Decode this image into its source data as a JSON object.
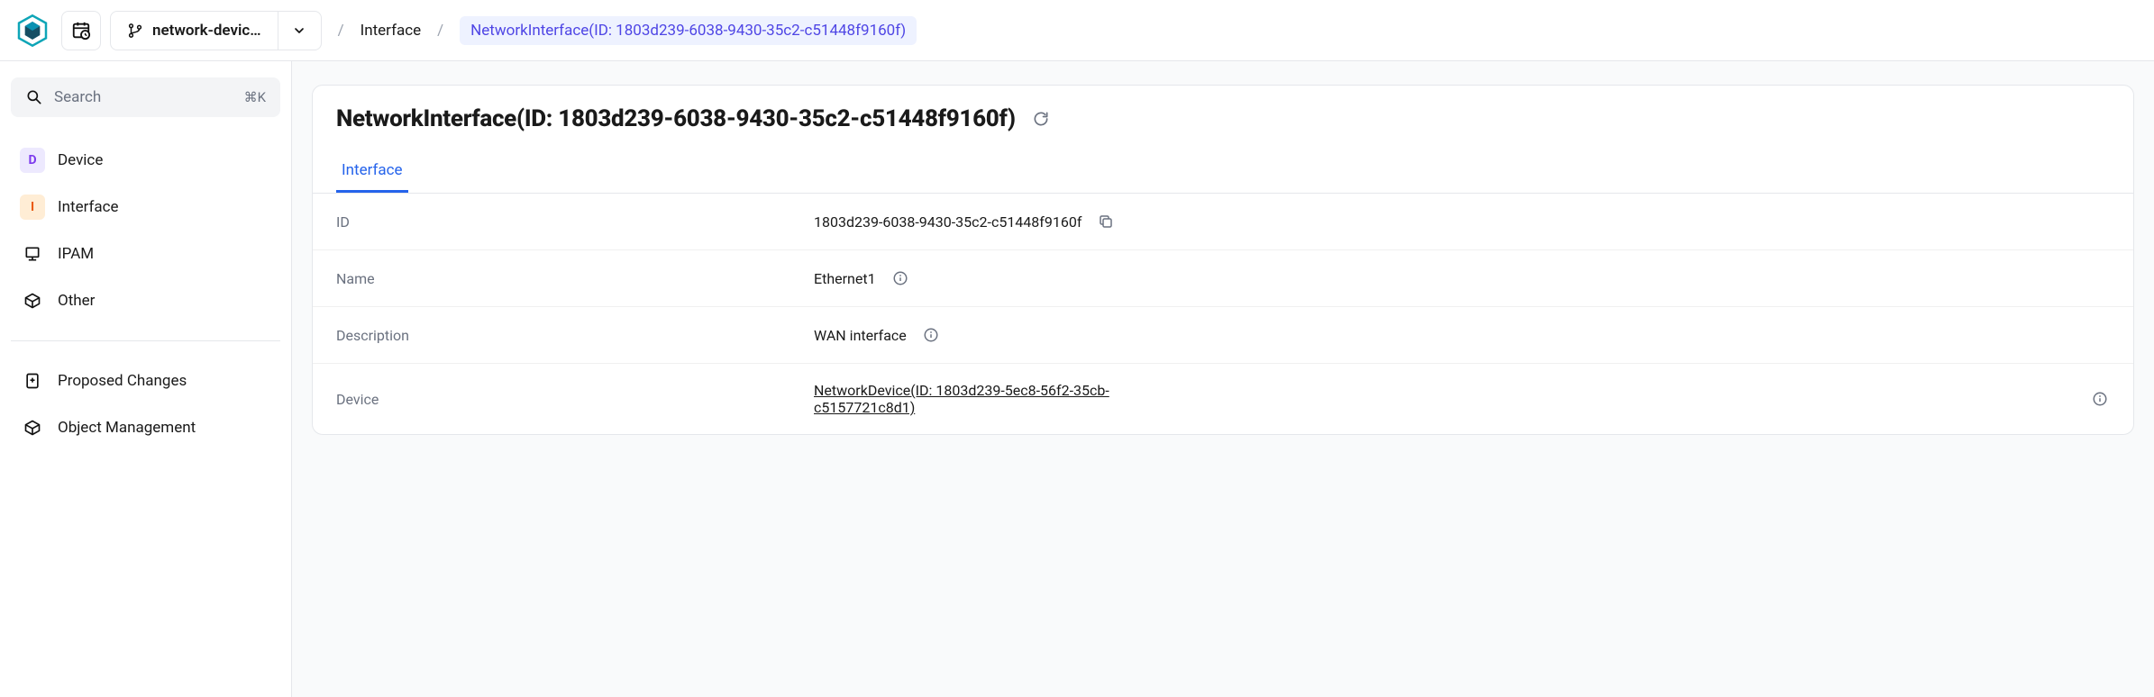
{
  "topbar": {
    "branch_name": "network-devic…"
  },
  "breadcrumb": {
    "item1": "Interface",
    "item2": "NetworkInterface(ID: 1803d239-6038-9430-35c2-c51448f9160f)"
  },
  "search": {
    "placeholder": "Search",
    "shortcut": "⌘K"
  },
  "sidebar": {
    "items": [
      {
        "letter": "D",
        "label": "Device"
      },
      {
        "letter": "I",
        "label": "Interface"
      },
      {
        "label": "IPAM"
      },
      {
        "label": "Other"
      }
    ],
    "secondary": [
      {
        "label": "Proposed Changes"
      },
      {
        "label": "Object Management"
      }
    ]
  },
  "page": {
    "title": "NetworkInterface(ID: 1803d239-6038-9430-35c2-c51448f9160f)",
    "tab": "Interface"
  },
  "details": {
    "rows": [
      {
        "label": "ID",
        "value": "1803d239-6038-9430-35c2-c51448f9160f"
      },
      {
        "label": "Name",
        "value": "Ethernet1"
      },
      {
        "label": "Description",
        "value": "WAN interface"
      },
      {
        "label": "Device",
        "value": "NetworkDevice(ID: 1803d239-5ec8-56f2-35cb-c5157721c8d1)"
      }
    ]
  }
}
